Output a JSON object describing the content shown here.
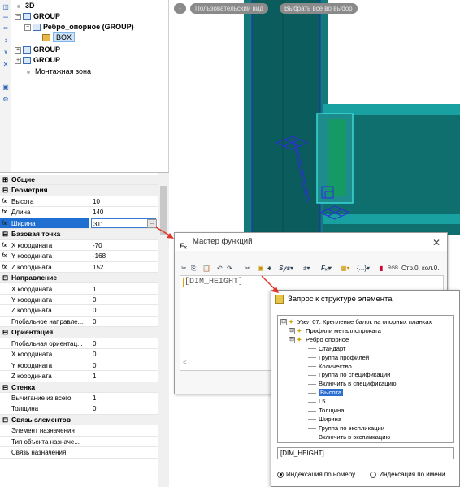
{
  "tree": {
    "items": [
      {
        "label": "3D",
        "icon": "point-icon"
      },
      {
        "label": "GROUP",
        "icon": "group-icon",
        "expander": "−"
      },
      {
        "label": "Ребро_опорное (GROUP)",
        "icon": "group-icon",
        "expander": "−"
      },
      {
        "label": "BOX",
        "icon": "box-icon"
      },
      {
        "label": "GROUP",
        "icon": "group-icon",
        "expander": "+"
      },
      {
        "label": "GROUP",
        "icon": "group-icon",
        "expander": "+"
      },
      {
        "label": "Монтажная зона",
        "icon": "point-icon"
      }
    ]
  },
  "viewport": {
    "tabs": [
      "-",
      "Пользовательский вид",
      "Выбрать все во выбор"
    ],
    "colors": {
      "beam": "#0e6e6e",
      "beam_light": "#1aa3a3",
      "edge": "#2d2dd6",
      "highlight": "#48e0e0"
    }
  },
  "properties": {
    "ellipsis": "...",
    "rows": [
      {
        "type": "cat",
        "expander": "⊞",
        "label": "Общие"
      },
      {
        "type": "cat",
        "expander": "⊟",
        "label": "Геометрия"
      },
      {
        "type": "prop",
        "fx": "fx",
        "label": "Высота",
        "value": "10"
      },
      {
        "type": "prop",
        "fx": "fx",
        "label": "Длина",
        "value": "140"
      },
      {
        "type": "prop",
        "fx": "fx",
        "label": "Ширина",
        "value": "311",
        "active": true
      },
      {
        "type": "cat",
        "expander": "⊟",
        "label": "Базовая точка"
      },
      {
        "type": "prop",
        "fx": "fx",
        "label": "X координата",
        "value": "-70"
      },
      {
        "type": "prop",
        "fx": "fx",
        "label": "Y координата",
        "value": "-168"
      },
      {
        "type": "prop",
        "fx": "fx",
        "label": "Z координата",
        "value": "152"
      },
      {
        "type": "cat",
        "expander": "⊟",
        "label": "Направление"
      },
      {
        "type": "prop",
        "label": "X координата",
        "value": "1"
      },
      {
        "type": "prop",
        "label": "Y координата",
        "value": "0"
      },
      {
        "type": "prop",
        "label": "Z координата",
        "value": "0"
      },
      {
        "type": "prop",
        "label": "Глобальное направле...",
        "value": "0"
      },
      {
        "type": "cat",
        "expander": "⊟",
        "label": "Ориентация"
      },
      {
        "type": "prop",
        "label": "Глобальная ориентац...",
        "value": "0"
      },
      {
        "type": "prop",
        "label": "X координата",
        "value": "0"
      },
      {
        "type": "prop",
        "label": "Y координата",
        "value": "0"
      },
      {
        "type": "prop",
        "label": "Z координата",
        "value": "1"
      },
      {
        "type": "cat",
        "expander": "⊟",
        "label": "Стенка"
      },
      {
        "type": "prop",
        "label": "Вычитание из всего",
        "value": "1"
      },
      {
        "type": "prop",
        "label": "Толщина",
        "value": "0"
      },
      {
        "type": "cat",
        "expander": "⊟",
        "label": "Связь элементов"
      },
      {
        "type": "prop",
        "label": "Элемент назначения",
        "value": ""
      },
      {
        "type": "prop",
        "label": "Тип объекта назначе...",
        "value": ""
      },
      {
        "type": "prop",
        "label": "Связь назначения",
        "value": ""
      }
    ]
  },
  "wizard": {
    "title": "Мастер функций",
    "logo": "Fₓ",
    "close": "✕",
    "toolbar": {
      "sys": "Sys",
      "rgb": "RGB",
      "status": "Стр.0, кол.0."
    },
    "code": "[DIM_HEIGHT]",
    "scroll_left": "<"
  },
  "query": {
    "title": "Запрос к структуре элемента",
    "tree": [
      {
        "label": "Узел 07. Крепление балок на опорных планках",
        "level": 0,
        "expander": "⊟",
        "star": true
      },
      {
        "label": "Профили металлопроката",
        "level": 1,
        "expander": "⊞",
        "star": true
      },
      {
        "label": "Ребро опорное",
        "level": 1,
        "expander": "⊟",
        "star": true
      },
      {
        "label": "Стандарт",
        "level": 2
      },
      {
        "label": "Группа профилей",
        "level": 2
      },
      {
        "label": "Количество",
        "level": 2
      },
      {
        "label": "Группа по спецификации",
        "level": 2
      },
      {
        "label": "Включить в спецификацию",
        "level": 2
      },
      {
        "label": "Высота",
        "level": 2,
        "selected": true
      },
      {
        "label": "L5",
        "level": 2
      },
      {
        "label": "Толщина",
        "level": 2
      },
      {
        "label": "Ширина",
        "level": 2
      },
      {
        "label": "Группа по экспликации",
        "level": 2
      },
      {
        "label": "Включить в экспликацию",
        "level": 2
      }
    ],
    "field": "[DIM_HEIGHT]",
    "radio_number": "Индексация по номеру",
    "radio_name": "Индексация по имени",
    "radio_selected": "number"
  },
  "colors": {
    "accent": "#1e6fd1",
    "arrow": "#e0352b",
    "code": "#555555"
  }
}
